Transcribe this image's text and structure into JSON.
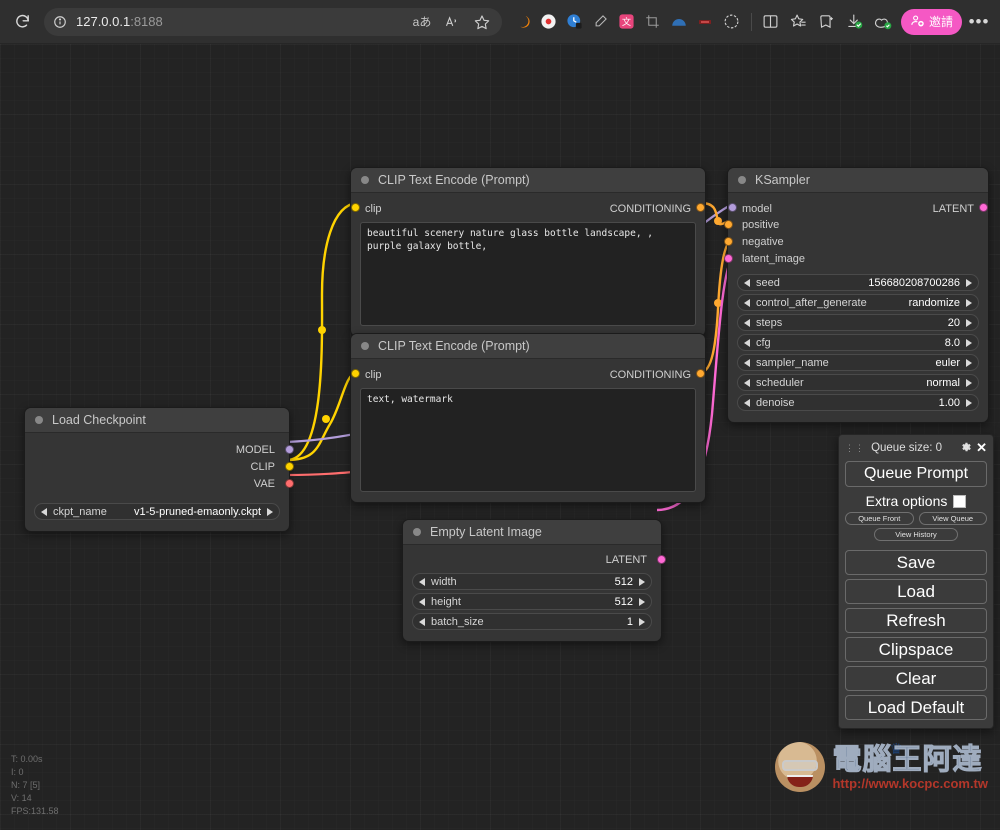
{
  "browser": {
    "reload_icon": "reload-icon",
    "info_icon": "site-info-icon",
    "url_host": "127.0.0.1",
    "url_port": ":8188",
    "translate_icon": "translate-icon",
    "read_aloud_icon": "read-aloud-icon",
    "favorite_icon": "star-icon",
    "extensions": [
      {
        "name": "extension-crescent-icon",
        "glyph": "◗"
      },
      {
        "name": "extension-record-icon",
        "glyph": "●"
      },
      {
        "name": "extension-clock-icon",
        "glyph": "◔"
      },
      {
        "name": "extension-pen-icon",
        "glyph": "✒"
      },
      {
        "name": "extension-translator-icon",
        "glyph": "文"
      },
      {
        "name": "extension-crop-icon",
        "glyph": "⛶"
      },
      {
        "name": "extension-arc-icon",
        "glyph": "◠"
      },
      {
        "name": "extension-minus-icon",
        "glyph": "➖"
      }
    ],
    "browser_essentials_icon": "browser-essentials-icon",
    "split_screen_icon": "split-screen-icon",
    "favorites_icon": "favorites-icon",
    "collections_icon": "collections-icon",
    "downloads_icon": "downloads-icon",
    "profile_icon": "profile-icon",
    "invite_label": "邀請",
    "invite_icon": "add-people-icon",
    "invite_color": "#f558c4",
    "more_label": "•••"
  },
  "nodes": {
    "clip_positive": {
      "title": "CLIP Text Encode (Prompt)",
      "input_label": "clip",
      "output_label": "CONDITIONING",
      "text": "beautiful scenery nature glass bottle landscape, , purple galaxy bottle,",
      "input_color": "#ffd300",
      "output_color": "#ffa931"
    },
    "clip_negative": {
      "title": "CLIP Text Encode (Prompt)",
      "input_label": "clip",
      "output_label": "CONDITIONING",
      "text": "text, watermark",
      "input_color": "#ffd300",
      "output_color": "#ffa931"
    },
    "ksampler": {
      "title": "KSampler",
      "inputs": [
        {
          "label": "model",
          "color": "#b39ddb"
        },
        {
          "label": "positive",
          "color": "#ffa931"
        },
        {
          "label": "negative",
          "color": "#ffa931"
        },
        {
          "label": "latent_image",
          "color": "#ff6ad5"
        }
      ],
      "outputs": [
        {
          "label": "LATENT",
          "color": "#ff6ad5"
        }
      ],
      "widgets": [
        {
          "name": "seed",
          "value": "156680208700286"
        },
        {
          "name": "control_after_generate",
          "value": "randomize"
        },
        {
          "name": "steps",
          "value": "20"
        },
        {
          "name": "cfg",
          "value": "8.0"
        },
        {
          "name": "sampler_name",
          "value": "euler"
        },
        {
          "name": "scheduler",
          "value": "normal"
        },
        {
          "name": "denoise",
          "value": "1.00"
        }
      ]
    },
    "checkpoint": {
      "title": "Load Checkpoint",
      "outputs": [
        {
          "label": "MODEL",
          "color": "#b39ddb"
        },
        {
          "label": "CLIP",
          "color": "#ffd300"
        },
        {
          "label": "VAE",
          "color": "#ff6e6e"
        }
      ],
      "widgets": [
        {
          "name": "ckpt_name",
          "value": "v1-5-pruned-emaonly.ckpt"
        }
      ]
    },
    "latent": {
      "title": "Empty Latent Image",
      "outputs": [
        {
          "label": "LATENT",
          "color": "#ff6ad5"
        }
      ],
      "widgets": [
        {
          "name": "width",
          "value": "512"
        },
        {
          "name": "height",
          "value": "512"
        },
        {
          "name": "batch_size",
          "value": "1"
        }
      ]
    }
  },
  "queue_panel": {
    "drag_handle": "⋮⋮",
    "queue_size_label": "Queue size: 0",
    "gear_icon": "gear-icon",
    "close_icon": "✕",
    "queue_prompt_label": "Queue Prompt",
    "extra_options_label": "Extra options",
    "queue_front_label": "Queue Front",
    "view_queue_label": "View Queue",
    "view_history_label": "View History",
    "buttons": [
      "Save",
      "Load",
      "Refresh",
      "Clipspace",
      "Clear",
      "Load Default"
    ]
  },
  "stats": {
    "time": "T: 0.00s",
    "iterations": "I: 0",
    "nodes": "N: 7 [5]",
    "version": "V: 14",
    "fps": "FPS:131.58"
  },
  "watermark": {
    "title": "電腦王阿達",
    "url": "http://www.kocpc.com.tw",
    "crown": "♛"
  }
}
